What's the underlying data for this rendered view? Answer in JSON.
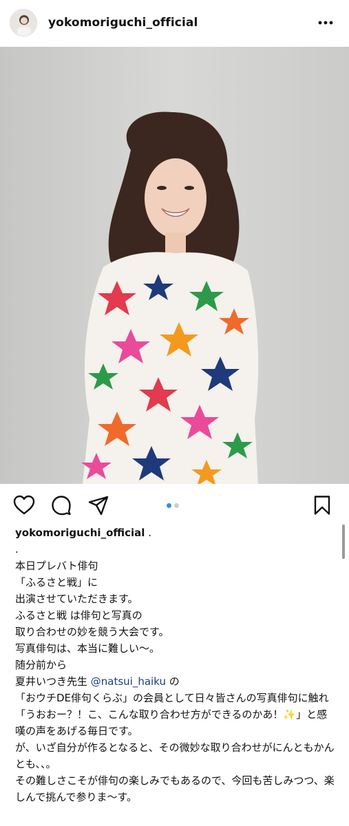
{
  "post": {
    "username": "yokomoriguchi_official",
    "more_icon": "more-horizontal-icon",
    "carousel": {
      "count": 2,
      "active_index": 1
    }
  },
  "actions": {
    "like_icon": "heart-icon",
    "comment_icon": "comment-bubble-icon",
    "share_icon": "send-plane-icon",
    "save_icon": "bookmark-icon"
  },
  "caption": {
    "username": "yokomoriguchi_official",
    "suffix": ".",
    "lines": {
      "l1": ".",
      "l2": "本日プレバト俳句",
      "l3": "「ふるさと戦」に",
      "l4": "出演させていただきます。",
      "l5": "ふるさと戦 は俳句と写真の",
      "l6": "取り合わせの妙を競う大会です。",
      "l7": "写真俳句は、本当に難しい〜。",
      "l8": "随分前から",
      "l9a": "夏井いつき先生 ",
      "l9_mention": "@natsui_haiku",
      "l9b": " の",
      "l10": "「おウチDE俳句くらぶ」の会員として日々皆さんの写真俳句に触れ",
      "l11": "「うおおー？！こ、こんな取り合わせ方ができるのかあ！✨」と感嘆の声をあげる毎日です。",
      "l12": "が、いざ自分が作るとなると、その微妙な取り合わせがにんともかんとも、、。",
      "l13": "その難しさこそが俳句の楽しみでもあるので、今回も苦しみつつ、楽しんで挑んで参りま〜す。"
    }
  },
  "colors": {
    "accent_dot": "#3a8be8",
    "mention": "#1d3b7a",
    "wall": "#cfcfcf"
  }
}
